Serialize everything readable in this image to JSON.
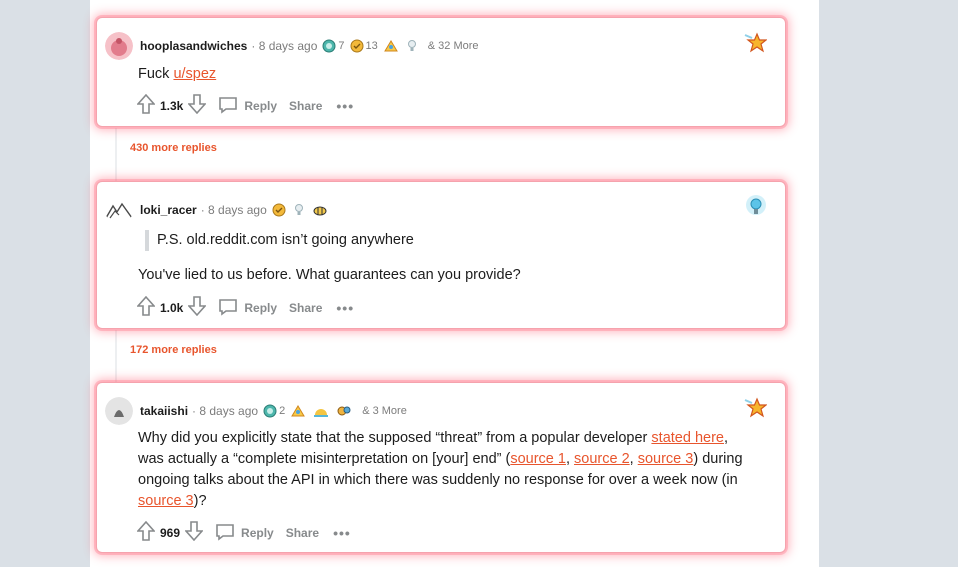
{
  "comments": [
    {
      "username": "hooplasandwiches",
      "time": "· 8 days ago",
      "awards": [
        {
          "icon": "silver-coin-award-icon",
          "count": "7"
        },
        {
          "icon": "helpful-award-icon",
          "count": "13"
        },
        {
          "icon": "rocket-award-icon",
          "count": ""
        },
        {
          "icon": "lightbulb-award-icon",
          "count": ""
        }
      ],
      "more_awards": "& 32 More",
      "text_prefix": "Fuck ",
      "link": "u/spez",
      "score": "1.3k",
      "reply_label": "Reply",
      "share_label": "Share",
      "corner_icon": "star-rocket-award-icon"
    },
    {
      "username": "loki_racer",
      "time": "· 8 days ago",
      "awards": [
        {
          "icon": "helpful-award-icon",
          "count": ""
        },
        {
          "icon": "lightbulb-award-icon",
          "count": ""
        },
        {
          "icon": "bee-award-icon",
          "count": ""
        }
      ],
      "quote": "P.S. old.reddit.com isn’t going anywhere",
      "text": "You've lied to us before. What guarantees can you provide?",
      "score": "1.0k",
      "reply_label": "Reply",
      "share_label": "Share",
      "corner_icon": "glowing-lightbulb-award-icon"
    },
    {
      "username": "takaiishi",
      "time": "· 8 days ago",
      "awards": [
        {
          "icon": "silver-coin-award-icon",
          "count": "2"
        },
        {
          "icon": "rocket-award-icon",
          "count": ""
        },
        {
          "icon": "sunrise-award-icon",
          "count": ""
        },
        {
          "icon": "gears-award-icon",
          "count": ""
        }
      ],
      "more_awards": "& 3 More",
      "text_a": "Why did you explicitly state that the supposed “threat” from a popular developer ",
      "link_a": "stated here",
      "text_b": ", was actually a “complete misinterpretation on [your] end” (",
      "link_b": "source 1",
      "sep_1": ", ",
      "link_c": "source 2",
      "sep_2": ", ",
      "link_d": "source 3",
      "text_c": ") during ongoing talks about the API in which there was suddenly no response for over a week now (in ",
      "link_e": "source 3",
      "text_d": ")?",
      "score": "969",
      "reply_label": "Reply",
      "share_label": "Share",
      "corner_icon": "star-rocket-award-icon"
    }
  ],
  "more_replies": [
    "430 more replies",
    "172 more replies"
  ],
  "colors": {
    "accent": "#e8552d",
    "glow": "#ff5a6e",
    "page_bg": "#dae0e6"
  }
}
